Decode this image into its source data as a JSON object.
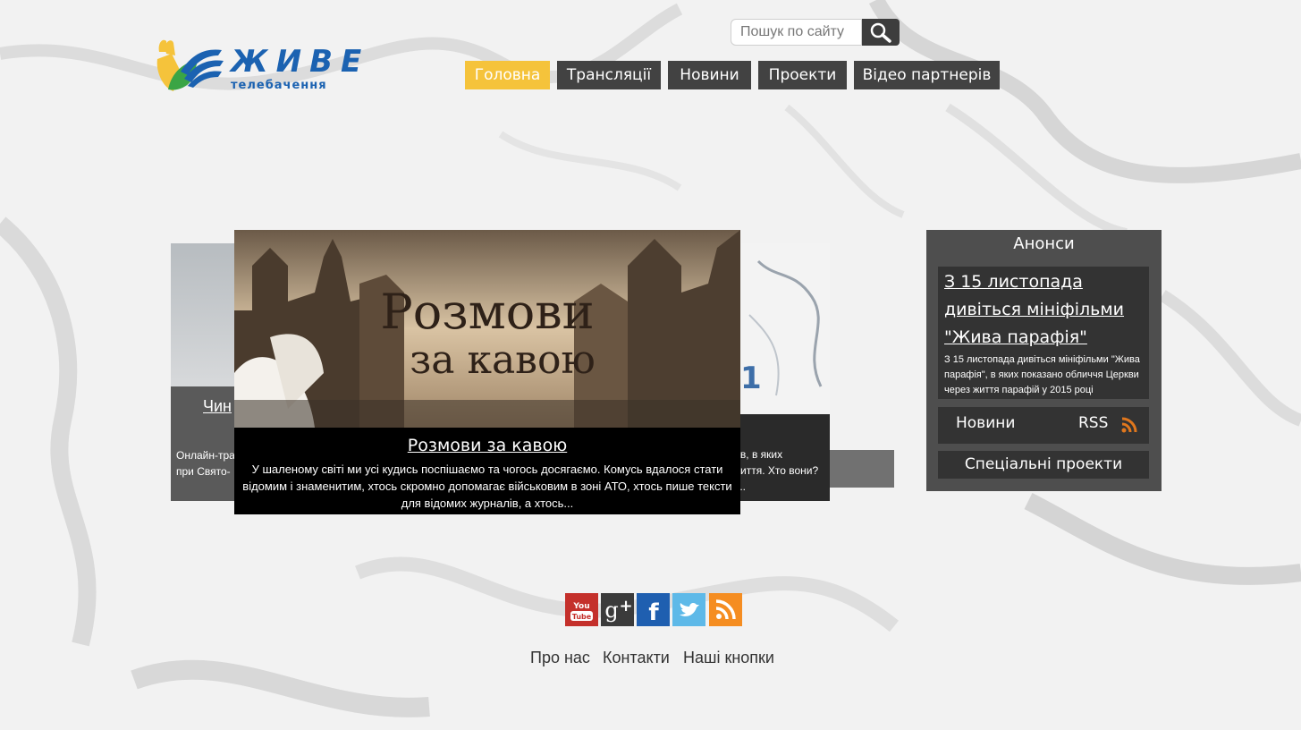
{
  "logo": {
    "word": "ЖИВЕ",
    "subtitle": "телебачення"
  },
  "search": {
    "placeholder": "Пошук по сайту"
  },
  "nav": [
    {
      "label": "Головна",
      "active": true
    },
    {
      "label": "Трансляції",
      "active": false
    },
    {
      "label": "Новини",
      "active": false
    },
    {
      "label": "Проекти",
      "active": false
    },
    {
      "label": "Відео партнерів",
      "active": false
    }
  ],
  "featured": {
    "title": "Розмови за кавою",
    "image_title_line1": "Розмови",
    "image_title_line2": "за кавою",
    "description": "У шаленому світі ми усі кудись поспішаємо та чогось досягаємо. Комусь вдалося стати відомим і знаменитим, хтось скромно допомагає військовим в зоні АТО, хтось пише тексти для відомих журналів, а хтось..."
  },
  "side_card_left": {
    "title_fragment": "Чин",
    "desc_line1": "Онлайн-тра",
    "desc_line2": "при Свято-"
  },
  "side_card_right": {
    "desc_line1": "ків, в яких",
    "desc_line2": "життя. Хто вони?",
    "desc_line3": "..."
  },
  "anons": {
    "heading": "Анонси",
    "link": "З 15 листопада дивіться мініфільми \"Жива парафія\"",
    "text": "З 15 листопада дивіться мініфільми \"Жива парафія\", в яких показано обличчя Церкви через життя парафій у 2015 році",
    "news_label": "Новини",
    "rss_label": "RSS",
    "special_label": "Спеціальні проекти"
  },
  "social": [
    "youtube-icon",
    "google-plus-icon",
    "facebook-icon",
    "twitter-icon",
    "rss-icon"
  ],
  "footer": [
    "Про нас",
    "Контакти",
    "Наші кнопки"
  ],
  "colors": {
    "accent": "#f5c33b",
    "nav_bg": "#424242",
    "brand_blue": "#1b62b1"
  }
}
